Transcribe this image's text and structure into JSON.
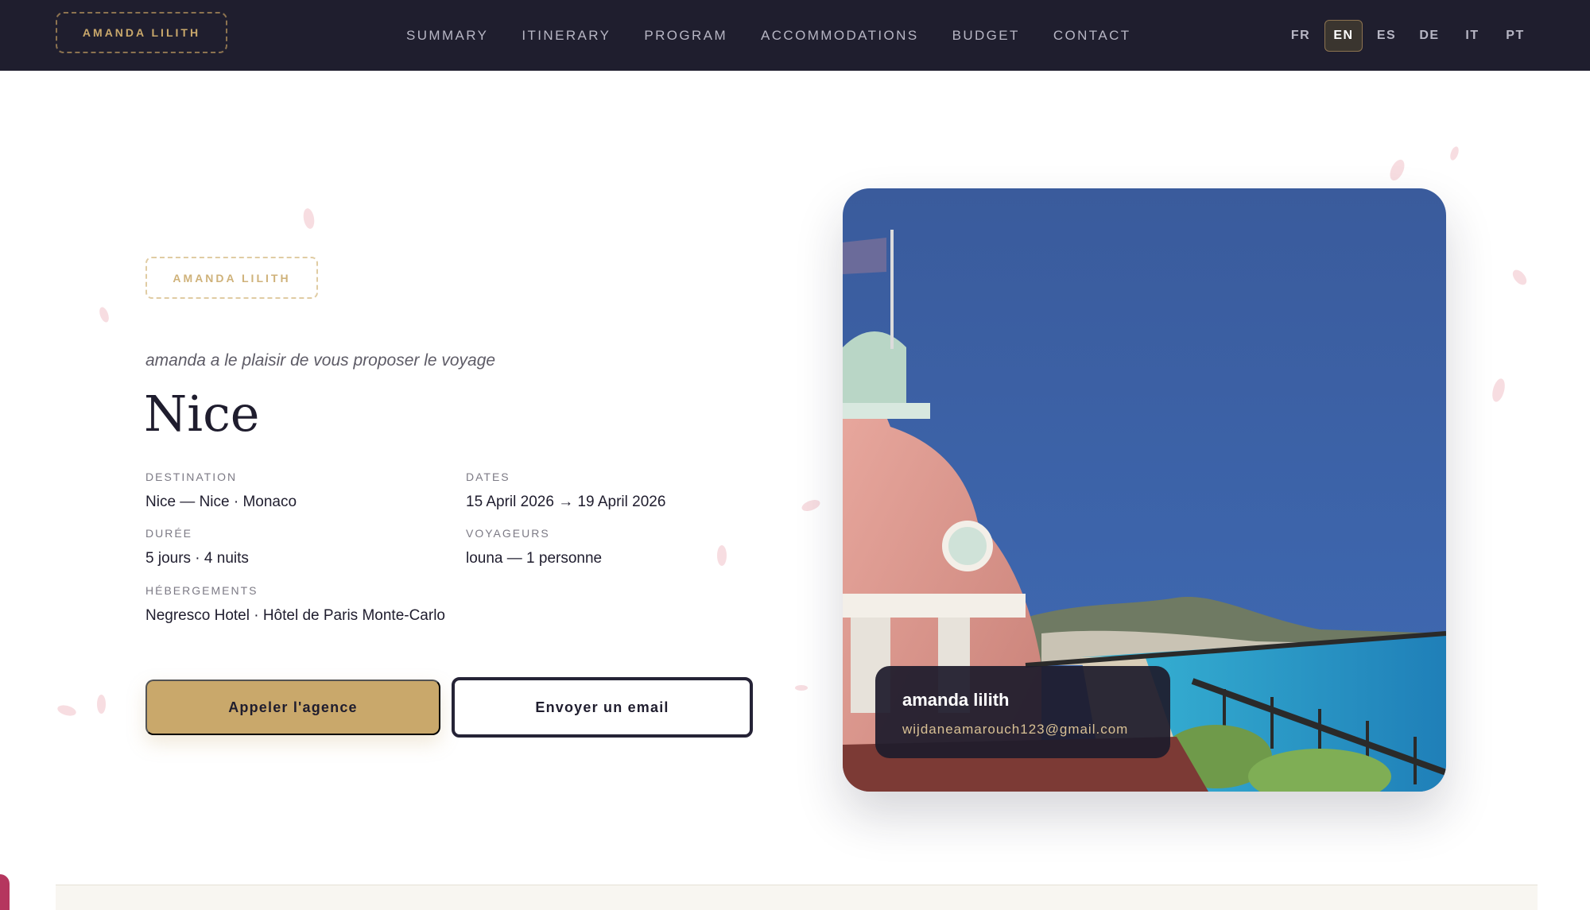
{
  "header": {
    "brand": "AMANDA LILITH",
    "nav": [
      "SUMMARY",
      "ITINERARY",
      "PROGRAM",
      "ACCOMMODATIONS",
      "BUDGET",
      "CONTACT"
    ],
    "languages": [
      "FR",
      "EN",
      "ES",
      "DE",
      "IT",
      "PT"
    ],
    "active_language": "EN"
  },
  "hero": {
    "badge": "AMANDA LILITH",
    "intro": "amanda a le plaisir de vous proposer le voyage",
    "title": "Nice",
    "fields": {
      "destination": {
        "label": "DESTINATION",
        "value": "Nice — Nice · Monaco"
      },
      "dates": {
        "label": "DATES",
        "value": "15 April 2026 → 19 April 2026"
      },
      "duration": {
        "label": "DURÉE",
        "value": "5 jours · 4 nuits"
      },
      "travelers": {
        "label": "VOYAGEURS",
        "value": "louna — 1 personne"
      },
      "accommodations": {
        "label": "HÉBERGEMENTS",
        "value": "Negresco Hotel · Hôtel de Paris Monte-Carlo"
      }
    },
    "buttons": {
      "call": "Appeler l'agence",
      "email": "Envoyer un email"
    }
  },
  "contact_card": {
    "name": "amanda lilith",
    "email": "wijdaneamarouch123@gmail.com"
  },
  "colors": {
    "nav_bg": "#1f1e2e",
    "accent_gold": "#c9a86b",
    "text_dark": "#1f1d2e",
    "petal_pink": "#f6d7dc"
  }
}
